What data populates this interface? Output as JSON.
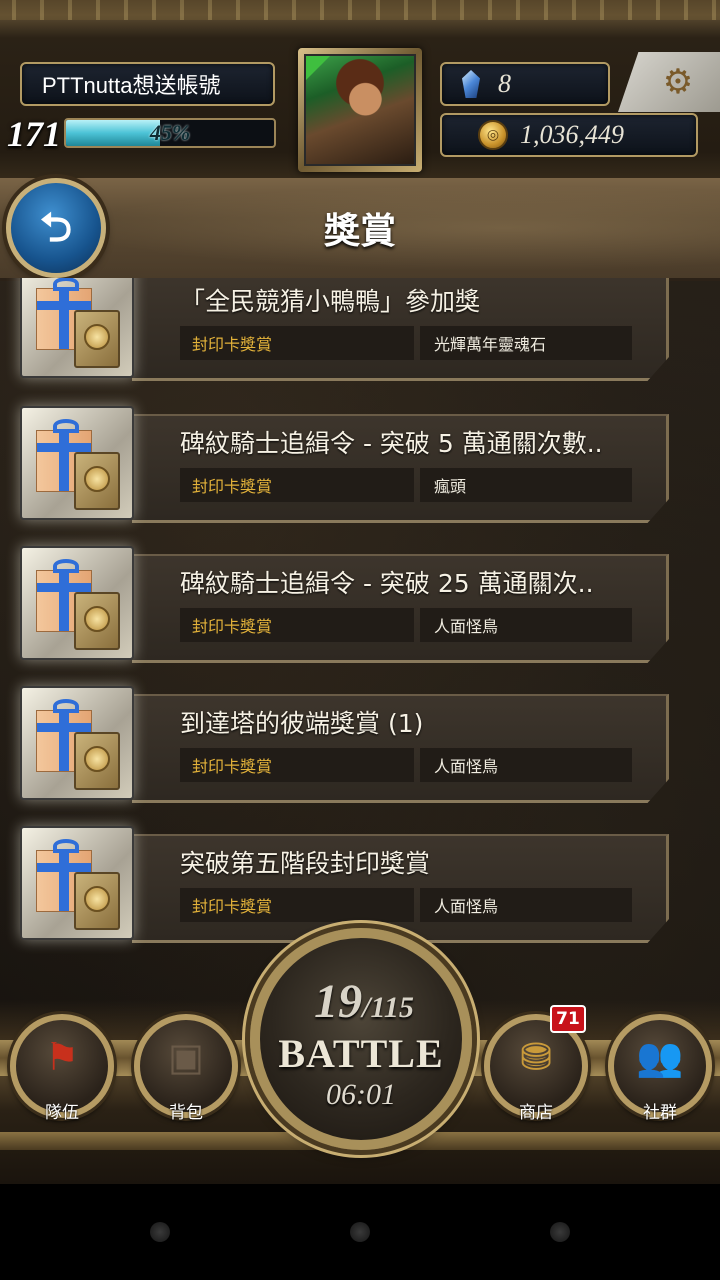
{
  "player": {
    "name": "PTTnutta想送帳號",
    "level": "171",
    "xp_percent_label": "45%",
    "xp_fraction": 0.45
  },
  "currency": {
    "gems": "8",
    "gold": "1,036,449"
  },
  "page": {
    "title": "獎賞"
  },
  "rewards": [
    {
      "title": "「全民競猜小鴨鴨」參加獎",
      "type": "封印卡獎賞",
      "item": "光輝萬年靈魂石"
    },
    {
      "title": "碑紋騎士追緝令 - 突破 5 萬通關次數..",
      "type": "封印卡獎賞",
      "item": "瘋頭"
    },
    {
      "title": "碑紋騎士追緝令 - 突破 25 萬通關次..",
      "type": "封印卡獎賞",
      "item": "人面怪鳥"
    },
    {
      "title": "到達塔的彼端獎賞 (1)",
      "type": "封印卡獎賞",
      "item": "人面怪鳥"
    },
    {
      "title": "突破第五階段封印獎賞",
      "type": "封印卡獎賞",
      "item": "人面怪鳥"
    }
  ],
  "battle": {
    "stamina_current": "19",
    "stamina_max": "/115",
    "label": "BATTLE",
    "timer": "06:01"
  },
  "nav": {
    "team": "隊伍",
    "bag": "背包",
    "shop": "商店",
    "shop_badge": "71",
    "social": "社群"
  },
  "icons": {
    "back": "back-arrow-icon",
    "settings": "gear-icon",
    "gem": "diamond-icon",
    "gold": "coin-icon",
    "reward": "gift-box-icon",
    "team": "red-flag-icon",
    "bag": "backpack-icon",
    "shop": "treasure-chest-icon",
    "social": "people-silhouette-icon"
  },
  "colors": {
    "xp_bar": "#4cc3d6",
    "reward_type_text": "#e3b23a",
    "badge_red": "#c8121a",
    "back_button_blue": "#17548e"
  }
}
